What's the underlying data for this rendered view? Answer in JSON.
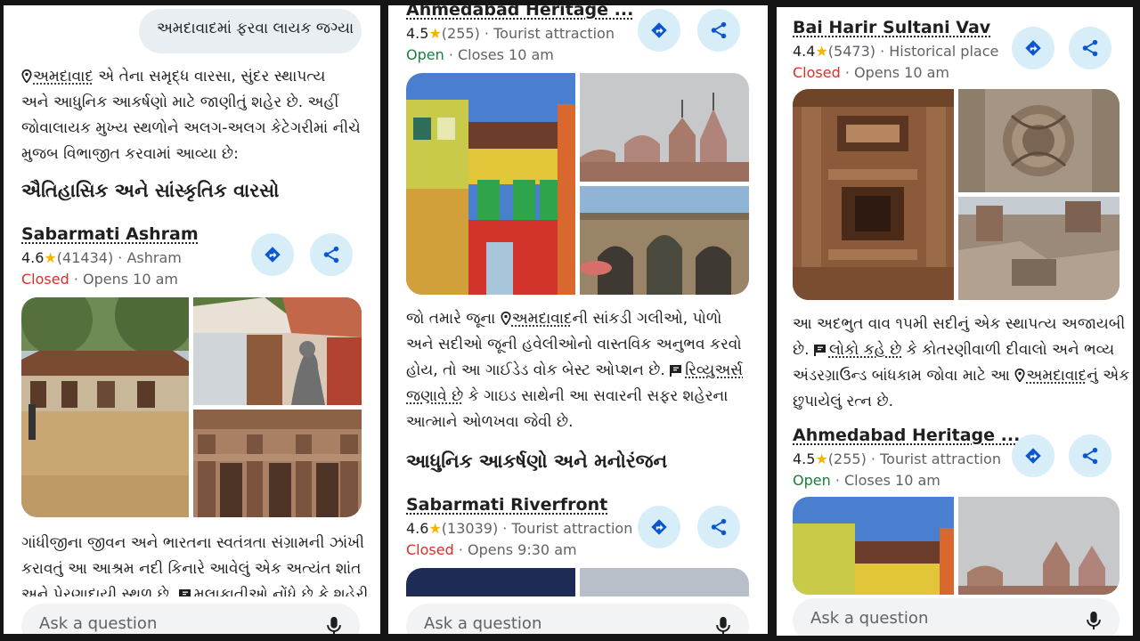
{
  "panel1": {
    "chip": "અમદાવાદમાં ફરવા લાયક જગ્યા",
    "intro": {
      "place_link": "અમદાવાદ",
      "line1_rest": " એ તેના સમૃદ્ધ વારસા, સુંદર સ્થાપત્ય",
      "line2": "અને આધુનિક આકર્ષણો માટે જાણીતું શહેર છે. અહીં",
      "line3": "જોવાલાયક મુખ્ય સ્થળોને અલગ-અલગ કેટેગરીમાં નીચે",
      "line4": "મુજબ વિભાજીત કરવામાં આવ્યા છે:"
    },
    "heading": "ઐતિહાસિક અને સાંસ્કૃતિક વારસો",
    "place": {
      "name": "Sabarmati Ashram",
      "rating": "4.6",
      "reviews": "(41434)",
      "category": "Ashram",
      "status": "Closed",
      "hours": "Opens 10 am"
    },
    "desc": {
      "line1": "ગાંધીજીના જીવન અને ભારતના સ્વતંત્રતા સંગ્રામની ઝાંખી",
      "line2": "કરાવતું આ આશ્રમ નદી કિનારે આવેલું એક અત્યંત શાંત",
      "line3": "અને પ્રેરણાદાયી સ્થળ છે.",
      "line3_link": "મુલાકાતીઓ નોંધે છે કે શહેરી"
    },
    "ask": "Ask a question"
  },
  "panel2": {
    "top_place": {
      "name": "Ahmedabad Heritage ...",
      "rating": "4.5",
      "reviews": "(255)",
      "category": "Tourist attraction",
      "status": "Open",
      "hours": "Closes 10 am"
    },
    "desc": {
      "line1_a": "જો તમારે જૂના ",
      "line1_link": "અમદાવાદ",
      "line1_b": "ની સાંકડી ગલીઓ, પોળો",
      "line2": "અને સદીઓ જૂની હવેલીઓનો વાસ્તવિક અનુભવ કરવો",
      "line3_a": "હોય, તો આ ગાઈડેડ વોક બેસ્ટ ઓપ્શન છે. ",
      "line3_link": "રિવ્યુઅર્સ",
      "line4_link": "જણાવે છે",
      "line4_b": " કે ગાઇડ સાથેની આ સવારની સફર શહેરના",
      "line5": "આત્માને ઓળખવા જેવી છે."
    },
    "heading": "આધુનિક આકર્ષણો અને મનોરંજન",
    "place": {
      "name": "Sabarmati Riverfront",
      "rating": "4.6",
      "reviews": "(13039)",
      "category": "Tourist attraction",
      "status": "Closed",
      "hours": "Opens 9:30 am"
    },
    "ask": "Ask a question"
  },
  "panel3": {
    "place": {
      "name": "Bai Harir Sultani Vav",
      "rating": "4.4",
      "reviews": "(5473)",
      "category": "Historical place",
      "status": "Closed",
      "hours": "Opens 10 am"
    },
    "desc": {
      "line1": "આ અદભુત વાવ ૧૫મી સદીનું એક સ્થાપત્ય અજાયબી",
      "line2_a": "છે. ",
      "line2_link": "લોકો કહે છે",
      "line2_b": " કે કોતરણીવાળી દીવાલો અને ભવ્ય",
      "line3_a": "અંડરગ્રાઉન્ડ બાંધકામ જોવા માટે આ ",
      "line3_link": "અમદાવાદ",
      "line3_b": "નું એક",
      "line4": "છુપાયેલું રત્ન છે."
    },
    "place2": {
      "name": "Ahmedabad Heritage ...",
      "rating": "4.5",
      "reviews": "(255)",
      "category": "Tourist attraction",
      "status": "Open",
      "hours": "Closes 10 am"
    },
    "ask": "Ask a question"
  },
  "icons": {
    "directions": "directions-icon",
    "share": "share-icon",
    "mic": "mic-icon",
    "pin": "location-pin-icon",
    "flag": "review-flag-icon",
    "star": "star-icon"
  },
  "colors": {
    "closed": "#d93025",
    "open": "#188038",
    "star": "#f4b400",
    "action_bg": "#d7eef9",
    "action_icon": "#0b57d0"
  }
}
